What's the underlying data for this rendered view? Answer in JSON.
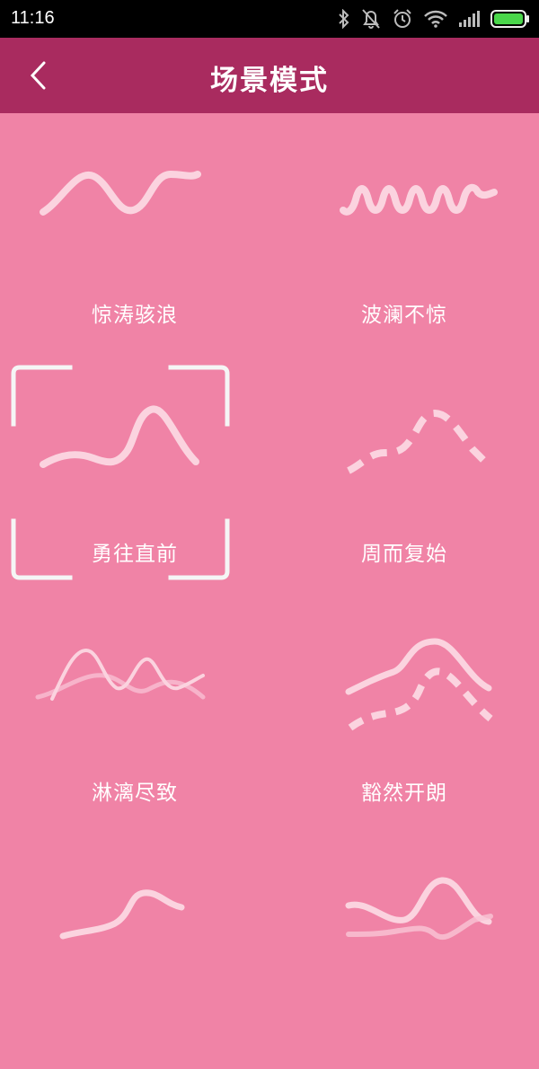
{
  "status": {
    "time": "11:16"
  },
  "header": {
    "title": "场景模式"
  },
  "modes": [
    {
      "label": "惊涛骇浪"
    },
    {
      "label": "波澜不惊"
    },
    {
      "label": "勇往直前"
    },
    {
      "label": "周而复始"
    },
    {
      "label": "淋漓尽致"
    },
    {
      "label": "豁然开朗"
    },
    {
      "label": ""
    },
    {
      "label": ""
    }
  ],
  "selected_index": 2,
  "colors": {
    "header": "#a92b5f",
    "background": "#f083a6",
    "wave": "#fbd3df"
  }
}
